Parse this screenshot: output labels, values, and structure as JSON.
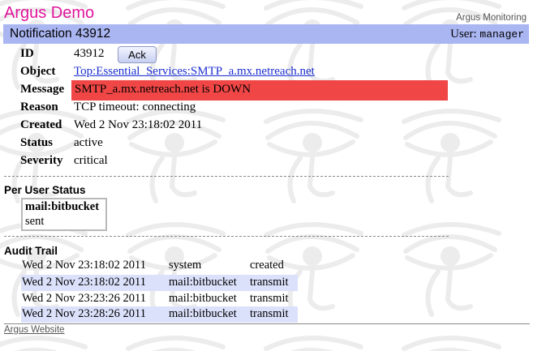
{
  "brand": {
    "name": "Argus Demo",
    "product": "Argus Monitoring"
  },
  "header": {
    "title": "Notification 43912",
    "user_label": "User:",
    "user_name": "manager"
  },
  "details": {
    "id_label": "ID",
    "id_value": "43912",
    "ack_label": "Ack",
    "object_label": "Object",
    "object_value": "Top:Essential_Services:SMTP_a.mx.netreach.net",
    "message_label": "Message",
    "message_value": "SMTP_a.mx.netreach.net is DOWN",
    "reason_label": "Reason",
    "reason_value": "TCP timeout: connecting",
    "created_label": "Created",
    "created_value": "Wed 2 Nov 23:18:02 2011",
    "status_label": "Status",
    "status_value": "active",
    "severity_label": "Severity",
    "severity_value": "critical"
  },
  "per_user": {
    "heading": "Per User Status",
    "entries": [
      {
        "user": "mail:bitbucket",
        "status": "sent"
      }
    ]
  },
  "audit": {
    "heading": "Audit Trail",
    "rows": [
      {
        "when": "Wed 2 Nov 23:18:02 2011",
        "who": "system",
        "what": "created"
      },
      {
        "when": "Wed 2 Nov 23:18:02 2011",
        "who": "mail:bitbucket",
        "what": "transmit"
      },
      {
        "when": "Wed 2 Nov 23:23:26 2011",
        "who": "mail:bitbucket",
        "what": "transmit"
      },
      {
        "when": "Wed 2 Nov 23:28:26 2011",
        "who": "mail:bitbucket",
        "what": "transmit"
      }
    ]
  },
  "footer": {
    "link": "Argus Website"
  },
  "colors": {
    "brand": "#e0159a",
    "header_bg": "#aab6f2",
    "message_bg": "#f04646",
    "row_shade": "#dbe1fb",
    "link": "#1c2fd0"
  },
  "icons": {
    "watermark": "eye-of-horus-icon"
  }
}
